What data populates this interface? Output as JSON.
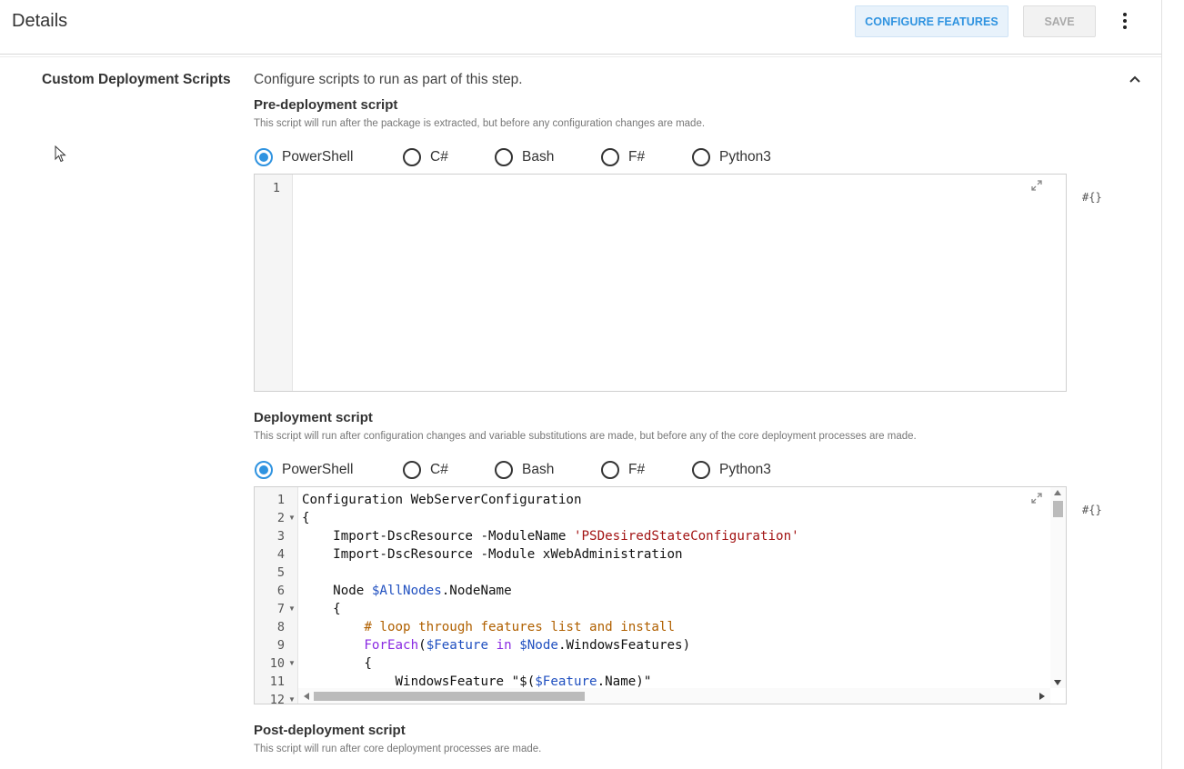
{
  "header": {
    "title": "Details",
    "configure_label": "CONFIGURE FEATURES",
    "save_label": "SAVE"
  },
  "section": {
    "label": "Custom Deployment Scripts",
    "description": "Configure scripts to run as part of this step."
  },
  "languages": [
    "PowerShell",
    "C#",
    "Bash",
    "F#",
    "Python3"
  ],
  "pre_deployment": {
    "title": "Pre-deployment script",
    "hint": "This script will run after the package is extracted, but before any configuration changes are made.",
    "selected_language": "PowerShell",
    "line_numbers": [
      "1"
    ]
  },
  "deployment": {
    "title": "Deployment script",
    "hint": "This script will run after configuration changes and variable substitutions are made, but before any of the core deployment processes are made.",
    "selected_language": "PowerShell",
    "line_numbers": [
      "1",
      "2",
      "3",
      "4",
      "5",
      "6",
      "7",
      "8",
      "9",
      "10",
      "11",
      "12"
    ],
    "code": [
      "Configuration WebServerConfiguration",
      "{",
      "    Import-DscResource -ModuleName 'PSDesiredStateConfiguration'",
      "    Import-DscResource -Module xWebAdministration",
      "",
      "    Node $AllNodes.NodeName",
      "    {",
      "        # loop through features list and install",
      "        ForEach($Feature in $Node.WindowsFeatures)",
      "        {",
      "            WindowsFeature \"$($Feature.Name)\""
    ]
  },
  "post_deployment": {
    "title": "Post-deployment script",
    "hint": "This script will run after core deployment processes are made."
  },
  "variable_icon_text": "#{}",
  "colors": {
    "accent": "#2f93e0",
    "keyword": "#8a2be2",
    "variable": "#2050c0",
    "string": "#a31515",
    "comment": "#b06000"
  }
}
